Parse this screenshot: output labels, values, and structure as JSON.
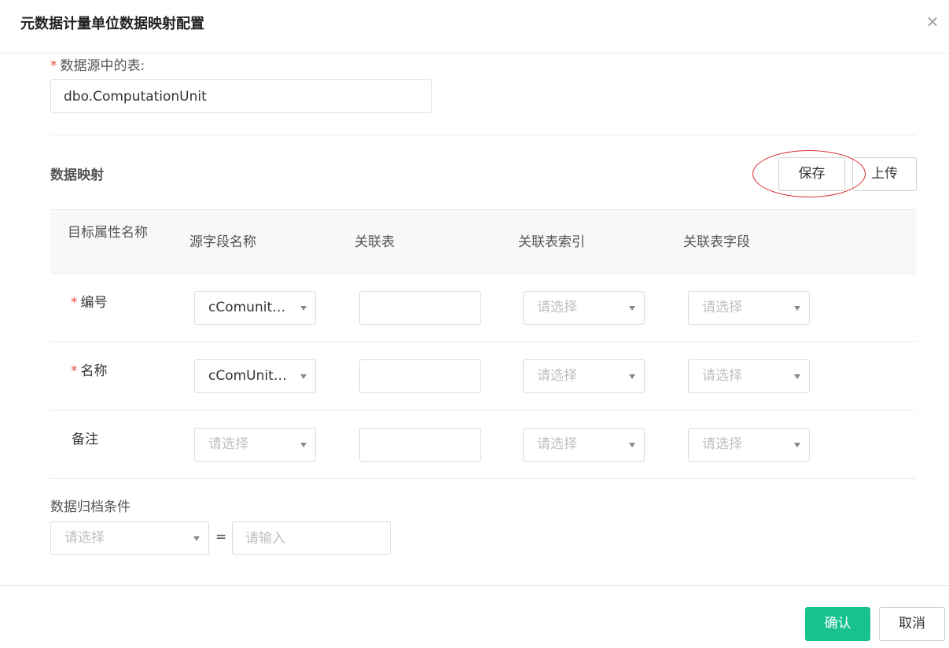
{
  "dialog": {
    "title": "元数据计量单位数据映射配置",
    "close_icon": "×"
  },
  "source_table": {
    "label": "数据源中的表:",
    "value": "dbo.ComputationUnit"
  },
  "mapping": {
    "title": "数据映射",
    "save_label": "保存",
    "upload_label": "上传",
    "columns": [
      "目标属性名称",
      "源字段名称",
      "关联表",
      "关联表索引",
      "关联表字段"
    ],
    "rows": [
      {
        "label": "编号",
        "required": true,
        "source_field": "cComunitCode",
        "related_table": "",
        "related_index": "请选择",
        "related_field": "请选择"
      },
      {
        "label": "名称",
        "required": true,
        "source_field": "cComUnitName",
        "related_table": "",
        "related_index": "请选择",
        "related_field": "请选择"
      },
      {
        "label": "备注",
        "required": false,
        "source_field": "请选择",
        "related_table": "",
        "related_index": "请选择",
        "related_field": "请选择"
      }
    ]
  },
  "archive": {
    "label": "数据归档条件",
    "select_placeholder": "请选择",
    "equals": "=",
    "input_placeholder": "请输入"
  },
  "footer": {
    "confirm_label": "确认",
    "cancel_label": "取消"
  },
  "colors": {
    "accent": "#18c28e",
    "required": "#e74c3c",
    "highlight": "#d62b2b"
  }
}
